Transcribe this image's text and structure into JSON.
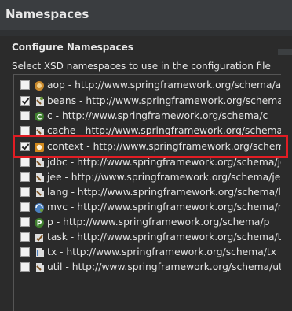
{
  "window": {
    "title": "Namespaces"
  },
  "section": {
    "title": "Configure Namespaces",
    "description": "Select XSD namespaces to use in the configuration file"
  },
  "namespaces": [
    {
      "label": "aop - http://www.springframework.org/schema/aop",
      "checked": false,
      "icon": "aop-bean-icon"
    },
    {
      "label": "beans - http://www.springframework.org/schema/bean",
      "checked": true,
      "icon": "beans-icon"
    },
    {
      "label": "c - http://www.springframework.org/schema/c",
      "checked": false,
      "icon": "c-namespace-icon"
    },
    {
      "label": "cache - http://www.springframework.org/schema/cach",
      "checked": false,
      "icon": "cache-icon"
    },
    {
      "label": "context - http://www.springframework.org/schema/co",
      "checked": true,
      "icon": "context-icon"
    },
    {
      "label": "jdbc - http://www.springframework.org/schema/jdbc",
      "checked": false,
      "icon": "jdbc-icon"
    },
    {
      "label": "jee - http://www.springframework.org/schema/jee",
      "checked": false,
      "icon": "jee-icon"
    },
    {
      "label": "lang - http://www.springframework.org/schema/lang",
      "checked": false,
      "icon": "lang-icon"
    },
    {
      "label": "mvc - http://www.springframework.org/schema/mvc",
      "checked": false,
      "icon": "mvc-icon"
    },
    {
      "label": "p - http://www.springframework.org/schema/p",
      "checked": false,
      "icon": "p-namespace-icon"
    },
    {
      "label": "task - http://www.springframework.org/schema/task",
      "checked": false,
      "icon": "task-icon"
    },
    {
      "label": "tx - http://www.springframework.org/schema/tx",
      "checked": false,
      "icon": "tx-icon"
    },
    {
      "label": "util - http://www.springframework.org/schema/util",
      "checked": false,
      "icon": "util-icon"
    }
  ],
  "highlight_color": "#e11d24"
}
